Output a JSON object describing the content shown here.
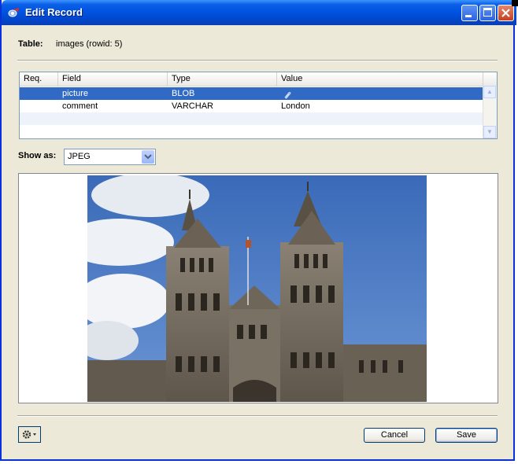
{
  "window": {
    "title": "Edit Record",
    "title_icon": "sqlite-app-icon"
  },
  "table_info": {
    "label": "Table:",
    "value": "images (rowid: 5)"
  },
  "grid": {
    "headers": [
      "Req.",
      "Field",
      "Type",
      "Value"
    ],
    "rows": [
      {
        "req": "",
        "field": "picture",
        "type": "BLOB",
        "value": "",
        "value_icon": "attachment-icon",
        "selected": true
      },
      {
        "req": "",
        "field": "comment",
        "type": "VARCHAR",
        "value": "London",
        "selected": false
      }
    ]
  },
  "show_as": {
    "label": "Show as:",
    "value": "JPEG"
  },
  "image": {
    "subject": "natural-history-museum-photo"
  },
  "buttons": {
    "cancel": "Cancel",
    "save": "Save",
    "options_icon": "gear-icon"
  },
  "colors": {
    "selection": "#316ac5",
    "titlebar": "#0054e3",
    "window_bg": "#ece9d8"
  }
}
